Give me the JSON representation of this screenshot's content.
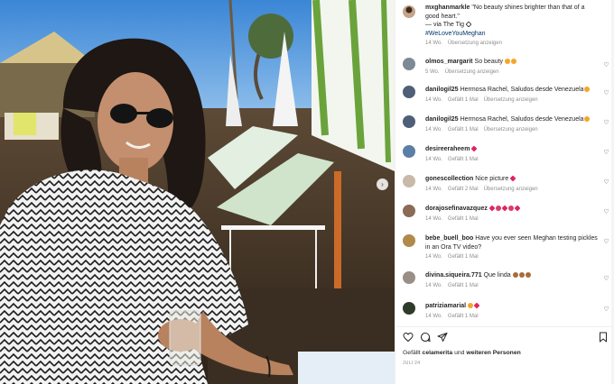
{
  "photo": {
    "alt": ""
  },
  "post": {
    "username": "mxghanmarkle",
    "caption_line1": "\"No beauty shines brighter than that of a good heart.\"",
    "caption_line2": "— via The Tig",
    "hashtag": "#WeLoveYouMeghan",
    "time": "14 Wo.",
    "translate": "Übersetzung anzeigen"
  },
  "comments": [
    {
      "username": "olmos_margarit",
      "text": "So beauty",
      "emojis": [
        "orange",
        "orange"
      ],
      "time": "5 Wo.",
      "likes": "",
      "translate": "Übersetzung anzeigen"
    },
    {
      "username": "danilogil25",
      "text": "Hermosa Rachel, Saludos desde Venezuela",
      "emojis": [
        "orange"
      ],
      "time": "14 Wo.",
      "likes": "Gefällt 1 Mal",
      "translate": "Übersetzung anzeigen"
    },
    {
      "username": "danilogil25",
      "text": "Hermosa Rachel, Saludos desde Venezuela",
      "emojis": [
        "orange"
      ],
      "time": "14 Wo.",
      "likes": "Gefällt 1 Mal",
      "translate": "Übersetzung anzeigen"
    },
    {
      "username": "desireeraheem",
      "text": "",
      "emojis": [
        "red"
      ],
      "time": "14 Wo.",
      "likes": "Gefällt 1 Mal",
      "translate": ""
    },
    {
      "username": "gonescollection",
      "text": "Nice picture",
      "emojis": [
        "red"
      ],
      "time": "14 Wo.",
      "likes": "Gefällt 2 Mal",
      "translate": "Übersetzung anzeigen"
    },
    {
      "username": "dorajosefinavazquez",
      "text": "",
      "emojis": [
        "red",
        "pink",
        "red",
        "pink",
        "red"
      ],
      "time": "14 Wo.",
      "likes": "Gefällt 1 Mal",
      "translate": ""
    },
    {
      "username": "bebe_buell_boo",
      "text": "Have you ever seen Meghan testing pickles in an Ora TV video?",
      "emojis": [],
      "time": "14 Wo.",
      "likes": "Gefällt 1 Mal",
      "translate": ""
    },
    {
      "username": "divina.siqueira.771",
      "text": "Que linda",
      "emojis": [
        "brown",
        "brown",
        "brown"
      ],
      "time": "14 Wo.",
      "likes": "Gefällt 1 Mal",
      "translate": ""
    },
    {
      "username": "patriziamarial",
      "text": "",
      "emojis": [
        "orange",
        "red"
      ],
      "time": "14 Wo.",
      "likes": "Gefällt 1 Mal",
      "translate": ""
    }
  ],
  "footer": {
    "likes_prefix": "Gefällt ",
    "likes_user": "celamerita",
    "likes_middle": " und ",
    "likes_suffix": "weiteren Personen",
    "date": "JULI 24"
  },
  "icons": {
    "heart": "heart-icon",
    "comment": "comment-icon",
    "share": "share-icon",
    "save": "bookmark-icon",
    "next": "chevron-right-icon"
  },
  "colors": {
    "link": "#00376b",
    "muted": "#8e8e8e",
    "text": "#262626"
  }
}
